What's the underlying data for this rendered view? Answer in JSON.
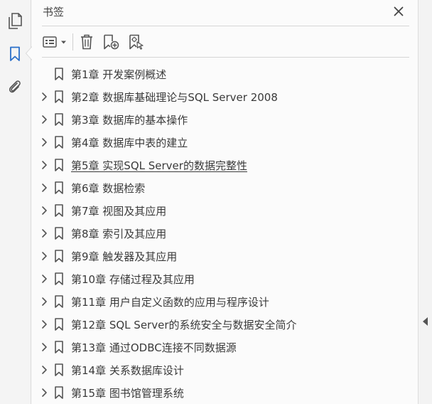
{
  "panel": {
    "title": "书签"
  },
  "rail": {
    "items": [
      {
        "name": "page-thumbnails-icon"
      },
      {
        "name": "bookmark-icon",
        "active": true
      },
      {
        "name": "attachment-icon"
      }
    ]
  },
  "toolbar": {
    "tools": [
      "options-menu-icon",
      "delete-icon",
      "new-bookmark-icon",
      "bookmark-from-structure-icon"
    ]
  },
  "colors": {
    "active_icon": "#2a6fc9",
    "icon": "#555555"
  },
  "bookmarks": [
    {
      "label": "第1章 开发案例概述",
      "expandable": false
    },
    {
      "label": "第2章 数据库基础理论与SQL Server 2008",
      "expandable": true
    },
    {
      "label": "第3章 数据库的基本操作",
      "expandable": true
    },
    {
      "label": "第4章 数据库中表的建立",
      "expandable": true
    },
    {
      "label": "第5章 实现SQL Server的数据完整性",
      "expandable": true,
      "selected": true
    },
    {
      "label": "第6章 数据检索",
      "expandable": true
    },
    {
      "label": "第7章 视图及其应用",
      "expandable": true
    },
    {
      "label": "第8章 索引及其应用",
      "expandable": true
    },
    {
      "label": "第9章 触发器及其应用",
      "expandable": true
    },
    {
      "label": "第10章 存储过程及其应用",
      "expandable": true
    },
    {
      "label": "第11章 用户自定义函数的应用与程序设计",
      "expandable": true
    },
    {
      "label": "第12章 SQL Server的系统安全与数据安全简介",
      "expandable": true
    },
    {
      "label": "第13章 通过ODBC连接不同数据源",
      "expandable": true
    },
    {
      "label": "第14章 关系数据库设计",
      "expandable": true
    },
    {
      "label": "第15章 图书馆管理系统",
      "expandable": true
    }
  ]
}
